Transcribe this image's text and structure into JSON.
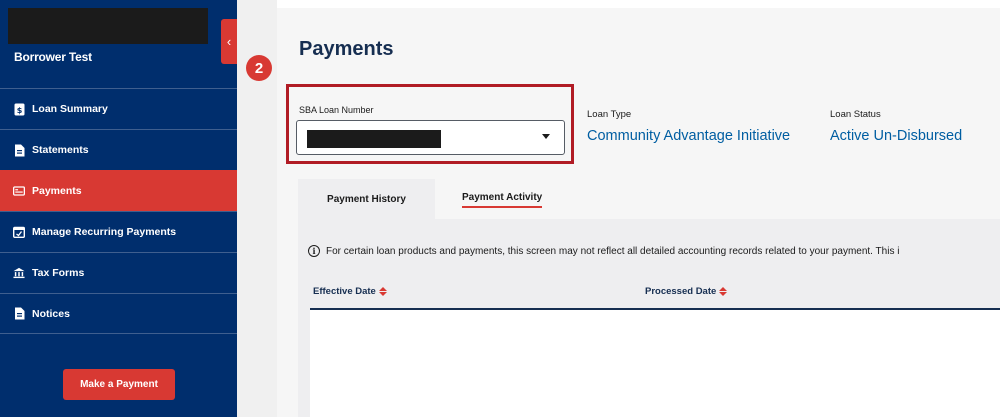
{
  "sidebar": {
    "user_name": "Borrower Test",
    "collapse_glyph": "‹",
    "items": [
      {
        "label": "Loan Summary",
        "icon": "document-dollar-icon",
        "active": false
      },
      {
        "label": "Statements",
        "icon": "document-icon",
        "active": false
      },
      {
        "label": "Payments",
        "icon": "card-icon",
        "active": true
      },
      {
        "label": "Manage Recurring Payments",
        "icon": "calendar-icon",
        "active": false
      },
      {
        "label": "Tax Forms",
        "icon": "bank-icon",
        "active": false
      },
      {
        "label": "Notices",
        "icon": "notice-icon",
        "active": false
      }
    ],
    "pay_button": "Make a Payment"
  },
  "step_badge": "2",
  "page": {
    "title": "Payments",
    "loan_number_label": "SBA Loan Number",
    "loan_type_label": "Loan Type",
    "loan_type_value": "Community Advantage Initiative",
    "loan_status_label": "Loan Status",
    "loan_status_value": "Active Un-Disbursed"
  },
  "tabs": {
    "history": "Payment History",
    "activity": "Payment Activity"
  },
  "notice": {
    "text": "For certain loan products and payments, this screen may not reflect all detailed accounting records related to your payment. This i",
    "icon_glyph": "i"
  },
  "table": {
    "columns": [
      "Effective Date",
      "Processed Date"
    ]
  },
  "colors": {
    "sidebar_bg": "#002e6d",
    "accent_red": "#d83933",
    "link_blue": "#005ea2",
    "highlight_border": "#b11c25"
  }
}
